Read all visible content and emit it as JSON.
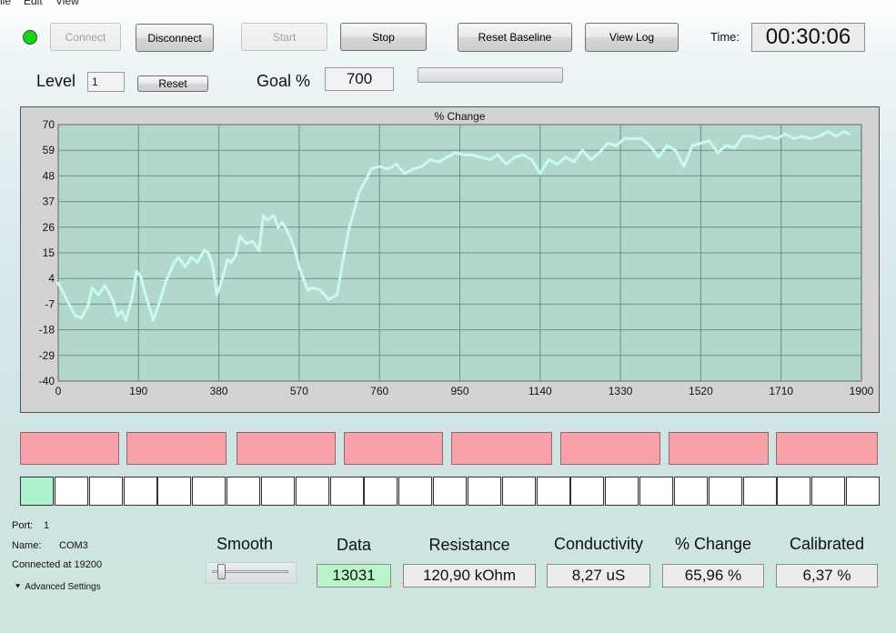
{
  "menu": {
    "file": "ile",
    "edit": "Edit",
    "view": "View"
  },
  "toolbar": {
    "connect": "Connect",
    "disconnect": "Disconnect",
    "start": "Start",
    "stop": "Stop",
    "reset_baseline": "Reset Baseline",
    "view_log": "View Log",
    "connection_led_color": "#18d418"
  },
  "timer": {
    "label": "Time:",
    "value": "00:30:06"
  },
  "level": {
    "label": "Level",
    "value": "1",
    "reset": "Reset"
  },
  "goal": {
    "label": "Goal %",
    "value": "700",
    "progress_fraction": 0.0
  },
  "chart_data": {
    "type": "line",
    "title": "% Change",
    "xlabel": "",
    "ylabel": "",
    "xlim": [
      0,
      1900
    ],
    "ylim": [
      -40,
      70
    ],
    "x_ticks": [
      "0",
      "190",
      "380",
      "570",
      "760",
      "950",
      "1140",
      "1330",
      "1520",
      "1710",
      "1900"
    ],
    "y_ticks": [
      "70",
      "59",
      "48",
      "37",
      "26",
      "15",
      "4",
      "-7",
      "-18",
      "-29",
      "-40"
    ],
    "grid": true,
    "colors": {
      "plot_bg": "#b3d7cd",
      "line": "#c8fbf0",
      "frame_bg": "#d3d3d3"
    },
    "series": [
      {
        "x": [
          0,
          20,
          40,
          55,
          70,
          80,
          95,
          110,
          120,
          130,
          140,
          150,
          160,
          175,
          185,
          195,
          205,
          215,
          225,
          240,
          255,
          265,
          275,
          285,
          300,
          315,
          330,
          345,
          355,
          365,
          375,
          380,
          390,
          400,
          410,
          420,
          430,
          445,
          460,
          475,
          485,
          495,
          510,
          520,
          530,
          540,
          550,
          560,
          570,
          580,
          590,
          600,
          620,
          640,
          660,
          670,
          680,
          690,
          700,
          710,
          720,
          730,
          740,
          760,
          780,
          800,
          820,
          840,
          860,
          880,
          900,
          920,
          940,
          960,
          980,
          1000,
          1020,
          1040,
          1060,
          1080,
          1100,
          1120,
          1140,
          1160,
          1180,
          1200,
          1220,
          1240,
          1260,
          1280,
          1300,
          1320,
          1340,
          1360,
          1380,
          1400,
          1420,
          1440,
          1460,
          1480,
          1500,
          1520,
          1540,
          1560,
          1580,
          1600,
          1620,
          1640,
          1660,
          1680,
          1700,
          1720,
          1740,
          1760,
          1780,
          1800,
          1820,
          1840,
          1860,
          1870
        ],
        "y": [
          2,
          -5,
          -12,
          -13,
          -8,
          0,
          -3,
          1,
          -2,
          -6,
          -12,
          -10,
          -14,
          -4,
          7,
          5,
          -2,
          -8,
          -14,
          -6,
          3,
          7,
          11,
          13,
          9,
          13,
          11,
          16,
          15,
          10,
          -3,
          -1,
          5,
          12,
          11,
          14,
          22,
          19,
          20,
          16,
          31,
          29,
          31,
          26,
          28,
          25,
          21,
          16,
          9,
          4,
          -1,
          0,
          -1,
          -5,
          -3,
          8,
          18,
          27,
          33,
          40,
          44,
          47,
          51,
          52,
          51,
          53,
          49,
          51,
          52,
          55,
          54,
          56,
          58,
          57,
          57,
          56,
          55,
          57,
          53,
          56,
          57,
          55,
          49,
          55,
          53,
          56,
          54,
          59,
          55,
          58,
          62,
          61,
          64,
          64,
          64,
          61,
          56,
          61,
          59,
          52,
          61,
          62,
          63,
          58,
          61,
          60,
          65,
          65,
          64,
          65,
          64,
          66,
          64,
          65,
          64,
          65,
          67,
          65,
          67,
          66
        ]
      }
    ]
  },
  "indicators": {
    "pink_count": 8,
    "squares_active": [
      true,
      false,
      false,
      false,
      false,
      false,
      false,
      false,
      false,
      false,
      false,
      false,
      false,
      false,
      false,
      false,
      false,
      false,
      false,
      false,
      false,
      false,
      false,
      false,
      false
    ],
    "pink_color": "#f7a1a8",
    "active_color": "#aef3cd"
  },
  "device": {
    "port_label": "Port:",
    "port_value": "1",
    "name_label": "Name:",
    "name_value": "COM3",
    "connected": "Connected at 19200",
    "advanced": "Advanced Settings"
  },
  "smooth": {
    "label": "Smooth",
    "level": 0.05
  },
  "readouts": {
    "data_label": "Data",
    "data_value": "13031",
    "resistance_label": "Resistance",
    "resistance_value": "120,90 kOhm",
    "conductivity_label": "Conductivity",
    "conductivity_value": "8,27 uS",
    "pct_change_label": "% Change",
    "pct_change_value": "65,96 %",
    "calibrated_label": "Calibrated",
    "calibrated_value": "6,37 %",
    "data_highlight_color": "#b8f5c8"
  }
}
